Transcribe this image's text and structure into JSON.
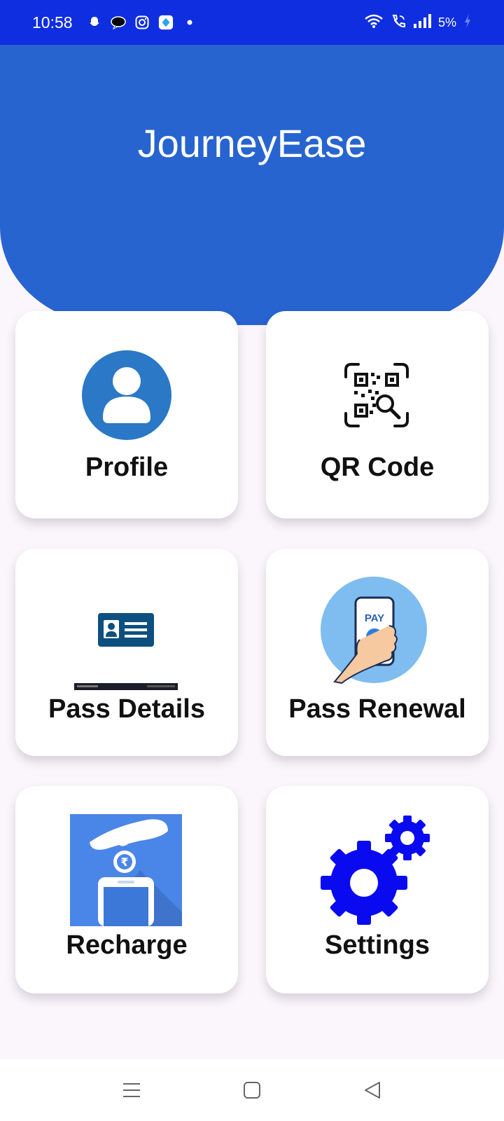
{
  "status_bar": {
    "time": "10:58",
    "battery": "5%",
    "left_icons": [
      "snapchat-icon",
      "chat-icon",
      "instagram-icon",
      "app-icon",
      "dot-icon"
    ],
    "right_icons": [
      "wifi-icon",
      "wifi-call-icon",
      "signal-icon",
      "battery-charging-icon"
    ]
  },
  "header": {
    "title": "JourneyEase",
    "color": "#2764cf"
  },
  "menu": [
    {
      "label": "Profile",
      "icon": "profile-icon"
    },
    {
      "label": "QR Code",
      "icon": "qr-scan-icon"
    },
    {
      "label": "Pass Details",
      "icon": "id-card-icon"
    },
    {
      "label": "Pass Renewal",
      "icon": "phone-pay-icon"
    },
    {
      "label": "Recharge",
      "icon": "recharge-icon"
    },
    {
      "label": "Settings",
      "icon": "gears-icon"
    }
  ],
  "nav": {
    "items": [
      "menu-icon",
      "home-icon",
      "back-icon"
    ]
  },
  "colors": {
    "status_bar": "#0f2ee0",
    "background": "#fbf6fb",
    "settings_blue": "#0a0af0"
  }
}
